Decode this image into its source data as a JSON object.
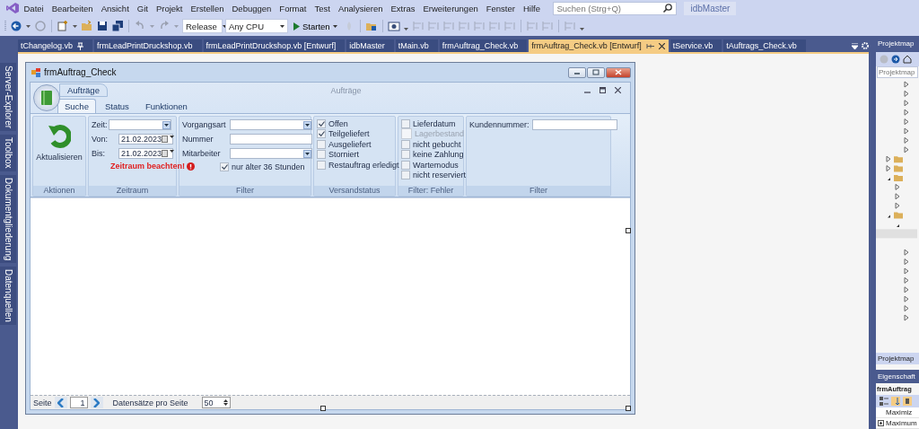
{
  "menu": [
    "Datei",
    "Bearbeiten",
    "Ansicht",
    "Git",
    "Projekt",
    "Erstellen",
    "Debuggen",
    "Format",
    "Test",
    "Analysieren",
    "Extras",
    "Erweiterungen",
    "Fenster",
    "Hilfe"
  ],
  "search": {
    "placeholder": "Suchen (Strg+Q)"
  },
  "solution_badge": "idbMaster",
  "toolbar": {
    "configuration": "Release",
    "platform": "Any CPU",
    "start": "Starten"
  },
  "side_tabs": [
    "Server-Explorer",
    "Toolbox",
    "Dokumentgliederung",
    "Datenquellen"
  ],
  "doc_tabs": [
    {
      "label": "tChangelog.vb",
      "selected": false,
      "pinned": true
    },
    {
      "label": "frmLeadPrintDruckshop.vb",
      "selected": false,
      "pinned": false
    },
    {
      "label": "frmLeadPrintDruckshop.vb [Entwurf]",
      "selected": false,
      "pinned": false
    },
    {
      "label": "idbMaster",
      "selected": false,
      "pinned": false
    },
    {
      "label": "tMain.vb",
      "selected": false,
      "pinned": false
    },
    {
      "label": "frmAuftrag_Check.vb",
      "selected": false,
      "pinned": false
    },
    {
      "label": "frmAuftrag_Check.vb [Entwurf]",
      "selected": true,
      "pinned": false
    },
    {
      "label": "tService.vb",
      "selected": false,
      "pinned": false
    },
    {
      "label": "tAuftrags_Check.vb",
      "selected": false,
      "pinned": false
    }
  ],
  "form": {
    "title": "frmAuftrag_Check",
    "quick_tab": "Aufträge",
    "ribbon_title": "Aufträge",
    "ribbon_tabs": [
      {
        "label": "Suche",
        "selected": true
      },
      {
        "label": "Status",
        "selected": false
      },
      {
        "label": "Funktionen",
        "selected": false
      }
    ],
    "aktionen": {
      "button": "Aktualisieren",
      "caption": "Aktionen"
    },
    "zeitraum": {
      "caption": "Zeitraum",
      "fields": [
        {
          "label": "Zeit:",
          "kind": "combo"
        },
        {
          "label": "Von:",
          "kind": "date",
          "value": "21.02.2023"
        },
        {
          "label": "Bis:",
          "kind": "date",
          "value": "21.02.2023"
        }
      ],
      "warning": "Zeitraum beachten!"
    },
    "filter": {
      "caption": "Filter",
      "fields": [
        {
          "label": "Vorgangsart",
          "kind": "combo"
        },
        {
          "label": "Nummer",
          "kind": "text"
        },
        {
          "label": "Mitarbeiter",
          "kind": "combo"
        }
      ],
      "option": {
        "label": "nur älter 36 Stunden",
        "checked": true
      }
    },
    "versandstatus": {
      "caption": "Versandstatus",
      "options": [
        {
          "label": "Offen",
          "checked": true,
          "disabled": false
        },
        {
          "label": "Teilgeliefert",
          "checked": true,
          "disabled": false
        },
        {
          "label": "Ausgeliefert",
          "checked": false,
          "disabled": false
        },
        {
          "label": "Storniert",
          "checked": false,
          "disabled": false
        },
        {
          "label": "Restauftrag erledigt",
          "checked": false,
          "disabled": false
        }
      ]
    },
    "fehler": {
      "caption": "Filter: Fehler",
      "options": [
        {
          "label": "Lieferdatum",
          "checked": false,
          "disabled": false
        },
        {
          "label": "Lagerbestand",
          "checked": false,
          "disabled": true
        },
        {
          "label": "nicht gebucht",
          "checked": false,
          "disabled": false
        },
        {
          "label": "keine Zahlung",
          "checked": false,
          "disabled": false
        },
        {
          "label": "Wartemodus",
          "checked": false,
          "disabled": false
        },
        {
          "label": "nicht reserviert",
          "checked": false,
          "disabled": false
        }
      ]
    },
    "kunden": {
      "caption": "Filter",
      "label": "Kundennummer:"
    },
    "pager": {
      "label": "Seite",
      "page": "1",
      "per_page_label": "Datensätze pro Seite",
      "per_page": "50"
    }
  },
  "right_panel": {
    "explorer_title": "Projektmap",
    "search_placeholder": "Projektmap",
    "bottom_tab": "Projektmap",
    "properties_title": "Eigenschaft",
    "object": "frmAuftrag",
    "rows": [
      {
        "label": "Maximiz",
        "expandable": false
      },
      {
        "label": "Maximum",
        "expandable": true
      }
    ]
  }
}
